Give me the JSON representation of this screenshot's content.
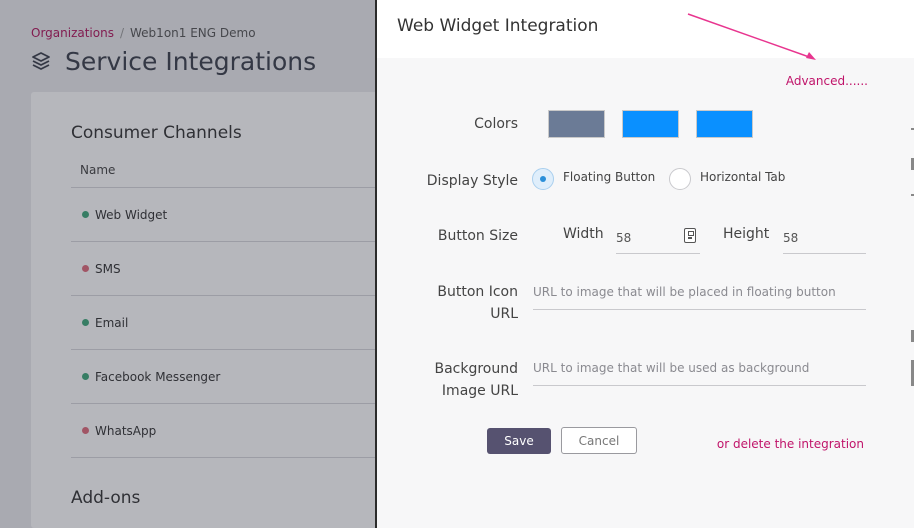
{
  "breadcrumb": {
    "org_link": "Organizations",
    "separator": "/",
    "current": "Web1on1 ENG Demo"
  },
  "page": {
    "title": "Service Integrations",
    "icon": "layers-icon"
  },
  "consumer_channels": {
    "title": "Consumer Channels",
    "column_header": "Name",
    "rows": [
      {
        "name": "Web Widget",
        "status_color": "#3fa87a"
      },
      {
        "name": "SMS",
        "status_color": "#e06b7c"
      },
      {
        "name": "Email",
        "status_color": "#3fa87a"
      },
      {
        "name": "Facebook Messenger",
        "status_color": "#3fa87a"
      },
      {
        "name": "WhatsApp",
        "status_color": "#e06b7c"
      }
    ]
  },
  "addons": {
    "title": "Add-ons"
  },
  "modal": {
    "title": "Web Widget Integration",
    "advanced_link": "Advanced......",
    "colors_label": "Colors",
    "colors": [
      "#6b7b96",
      "#0a90ff",
      "#0a90ff"
    ],
    "display_style_label": "Display Style",
    "display_style_options": [
      {
        "label": "Floating Button",
        "selected": true
      },
      {
        "label": "Horizontal Tab",
        "selected": false
      }
    ],
    "button_size_label": "Button Size",
    "width_label": "Width",
    "width_value": "58",
    "height_label": "Height",
    "height_value": "58",
    "icon_url_label_line1": "Button Icon",
    "icon_url_label_line2": "URL",
    "icon_url_placeholder": "URL to image that will be placed in floating button",
    "bg_url_label_line1": "Background",
    "bg_url_label_line2": "Image URL",
    "bg_url_placeholder": "URL to image that will be used as background",
    "save_label": "Save",
    "cancel_label": "Cancel",
    "delete_link": "or delete the integration"
  },
  "accent_colors": {
    "brand_link": "#c0146a",
    "primary_button": "#565270",
    "annotation_arrow": "#e8358f"
  }
}
